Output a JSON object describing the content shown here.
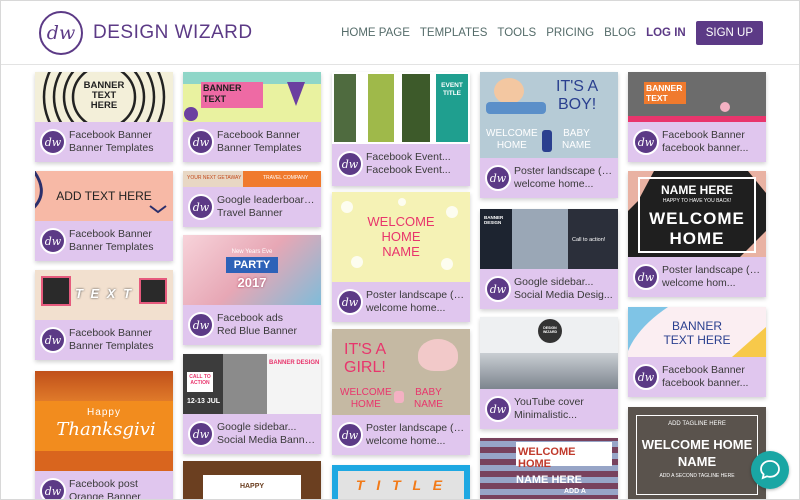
{
  "brand": {
    "logo_mark": "dw",
    "name": "DESIGN WIZARD"
  },
  "nav": {
    "home": "HOME PAGE",
    "templates": "TEMPLATES",
    "tools": "TOOLS",
    "pricing": "PRICING",
    "blog": "BLOG",
    "login": "LOG IN",
    "signup": "SIGN UP"
  },
  "avatar_mark": "dw",
  "cards": [
    {
      "line1": "Facebook Banner",
      "line2": "Banner Templates",
      "art": [
        "BANNER",
        "TEXT",
        "HERE"
      ]
    },
    {
      "line1": "Facebook Banner",
      "line2": "Banner Templates",
      "art": [
        "ADD TEXT HERE"
      ]
    },
    {
      "line1": "Facebook Banner",
      "line2": "Banner Templates",
      "art": [
        "T E X T"
      ]
    },
    {
      "line1": "Facebook post",
      "line2": "Orange Banner",
      "art": [
        "Happy",
        "Thanksgivi"
      ]
    },
    {
      "line1": "Facebook Banner",
      "line2": "Banner Templates",
      "art": [
        "BANNER",
        "TEXT"
      ]
    },
    {
      "line1": "Google leaderboard...",
      "line2": "Travel Banner",
      "art": [
        "YOUR NEXT GETAWAY",
        "TRAVEL COMPANY"
      ]
    },
    {
      "line1": "Facebook ads",
      "line2": "Red Blue Banner",
      "art": [
        "New Years Eve",
        "PARTY",
        "2017"
      ]
    },
    {
      "line1": "Google sidebar...",
      "line2": "Social Media Banne...",
      "art": [
        "BANNER DESIGN",
        "CALL TO ACTION",
        "12-13 JUL"
      ]
    },
    {
      "line1": "",
      "line2": "",
      "art": [
        "HAPPY"
      ]
    },
    {
      "line1": "Facebook Event...",
      "line2": "Facebook Event...",
      "art": [
        "EVENT",
        "TITLE"
      ]
    },
    {
      "line1": "Poster landscape (US)",
      "line2": "welcome home...",
      "art": [
        "WELCOME",
        "HOME",
        "NAME"
      ]
    },
    {
      "line1": "Poster landscape (US)",
      "line2": "welcome home...",
      "art": [
        "IT'S A",
        "GIRL!",
        "WELCOME",
        "HOME",
        "BABY",
        "NAME"
      ]
    },
    {
      "line1": "",
      "line2": "",
      "art": [
        "T I T L E"
      ]
    },
    {
      "line1": "Poster landscape (US)",
      "line2": "welcome home...",
      "art": [
        "IT'S A",
        "BOY!",
        "WELCOME",
        "HOME",
        "BABY",
        "NAME"
      ]
    },
    {
      "line1": "Google sidebar...",
      "line2": "Social Media Desig...",
      "art": [
        "BANNER DESIGN",
        "Call to action!"
      ]
    },
    {
      "line1": "YouTube cover",
      "line2": "Minimalistic...",
      "art": [
        "DESIGN WIZARD"
      ]
    },
    {
      "line1": "",
      "line2": "",
      "art": [
        "WELCOME",
        "HOME",
        "NAME HERE",
        "ADD A"
      ]
    },
    {
      "line1": "Facebook Banner",
      "line2": "facebook banner...",
      "art": [
        "BANNER",
        "TEXT"
      ]
    },
    {
      "line1": "Poster landscape (US)",
      "line2": "welcome hom...",
      "art": [
        "NAME HERE",
        "HAPPY TO HAVE YOU BACK!",
        "WELCOME",
        "HOME"
      ]
    },
    {
      "line1": "Facebook Banner",
      "line2": "facebook banner...",
      "art": [
        "BANNER",
        "TEXT HERE"
      ]
    },
    {
      "line1": "",
      "line2": "",
      "art": [
        "ADD TAGLINE HERE",
        "WELCOME HOME",
        "NAME",
        "ADD A SECOND TAGLINE HERE"
      ]
    }
  ],
  "colors": {
    "brand_purple": "#5c3a86",
    "card_footer": "#e0c6ee",
    "chat": "#1aa6a4"
  },
  "chat_icon": "chat-bubble-icon"
}
